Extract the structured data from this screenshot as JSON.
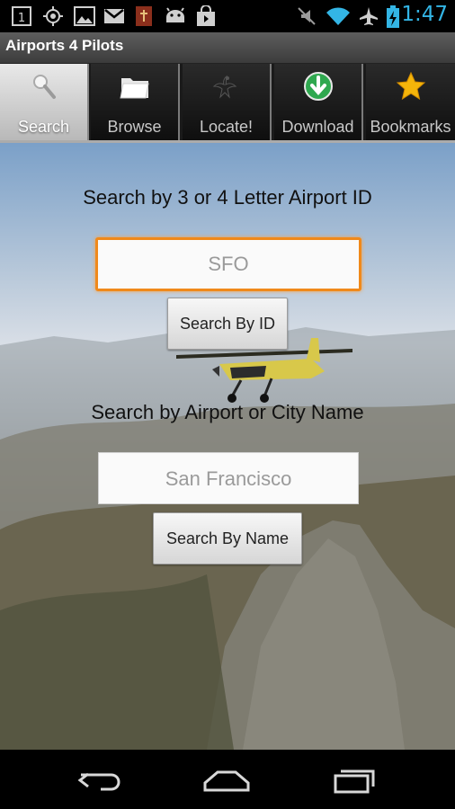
{
  "status_bar": {
    "time": "1:47",
    "notification_badge": "1",
    "icons": [
      "notification-count-icon",
      "gps-icon",
      "image-icon",
      "gmail-icon",
      "bible-icon",
      "android-icon",
      "shopping-bag-icon",
      "mute-icon",
      "wifi-icon",
      "airplane-mode-icon",
      "battery-charging-icon"
    ],
    "time_color": "#33b5e5"
  },
  "app": {
    "title": "Airports 4 Pilots"
  },
  "tabs": [
    {
      "label": "Search",
      "icon": "magnifier-icon",
      "selected": true
    },
    {
      "label": "Browse",
      "icon": "folder-icon",
      "selected": false
    },
    {
      "label": "Locate!",
      "icon": "eagle-icon",
      "selected": false
    },
    {
      "label": "Download",
      "icon": "download-arrow-icon",
      "selected": false
    },
    {
      "label": "Bookmarks",
      "icon": "star-icon",
      "selected": false
    }
  ],
  "search_by_id": {
    "heading": "Search by 3 or 4 Letter Airport ID",
    "placeholder": "SFO",
    "value": "",
    "button_label": "Search By ID"
  },
  "search_by_name": {
    "heading": "Search by Airport or City Name",
    "placeholder": "San Francisco",
    "value": "",
    "button_label": "Search By Name"
  },
  "nav": {
    "icons": [
      "back-icon",
      "home-icon",
      "recent-apps-icon"
    ]
  },
  "colors": {
    "focus_border": "#f0891a",
    "download_green": "#2fa84f",
    "star_yellow": "#f5b50a"
  }
}
